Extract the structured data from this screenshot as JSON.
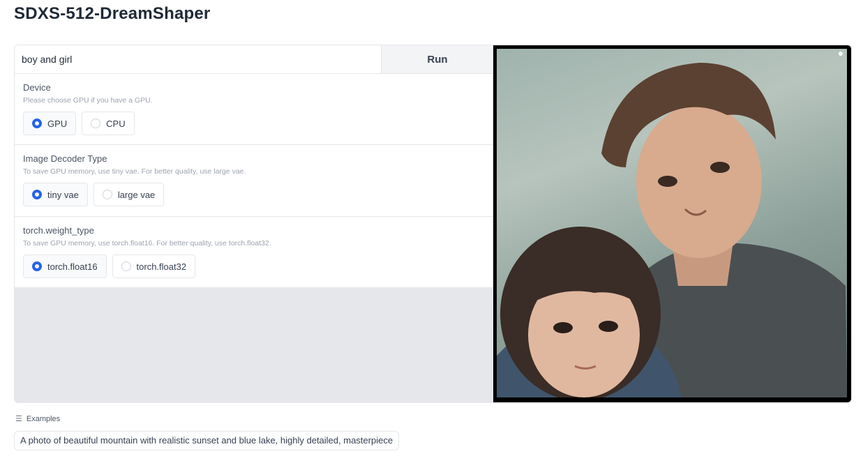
{
  "app": {
    "title": "SDXS-512-DreamShaper"
  },
  "prompt": {
    "value": "boy and girl",
    "run_label": "Run"
  },
  "device": {
    "label": "Device",
    "info": "Please choose GPU if you have a GPU.",
    "options": [
      "GPU",
      "CPU"
    ],
    "selected": "GPU"
  },
  "decoder": {
    "label": "Image Decoder Type",
    "info": "To save GPU memory, use tiny vae. For better quality, use large vae.",
    "options": [
      "tiny vae",
      "large vae"
    ],
    "selected": "tiny vae"
  },
  "weight_type": {
    "label": "torch.weight_type",
    "info": "To save GPU memory, use torch.float16. For better quality, use torch.float32.",
    "options": [
      "torch.float16",
      "torch.float32"
    ],
    "selected": "torch.float16"
  },
  "output": {
    "image_subject": "painted portrait of a boy and a girl"
  },
  "examples": {
    "label": "Examples",
    "icon": "list-icon",
    "items": [
      "A photo of beautiful mountain with realistic sunset and blue lake, highly detailed, masterpiece"
    ]
  },
  "colors": {
    "accent": "#2563eb",
    "panel_bg": "#e5e7eb"
  }
}
